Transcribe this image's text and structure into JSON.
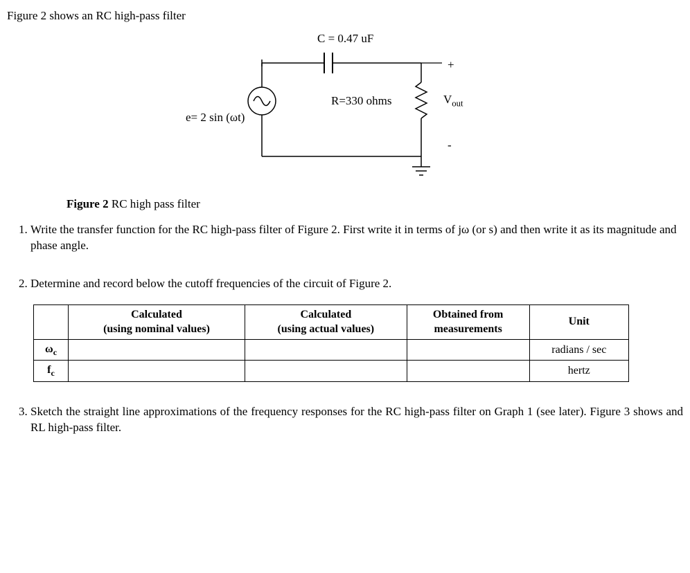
{
  "intro": "Figure 2 shows an RC high-pass filter",
  "circuit": {
    "c_label": "C = 0.47 uF",
    "r_label": "R=330 ohms",
    "source_label": "e= 2 sin (ωt)",
    "vout_label": "Vout",
    "plus": "+",
    "minus": "-"
  },
  "caption_bold": "Figure 2",
  "caption_rest": " RC high pass filter",
  "questions": {
    "q1": "Write the transfer function for the RC high-pass filter of Figure 2. First write it in terms of jω (or s) and then write it as its magnitude and phase angle.",
    "q2": "Determine and record below the cutoff frequencies of the circuit of Figure 2.",
    "q3": "Sketch the straight line approximations of the frequency responses for the RC high-pass filter on Graph 1 (see later). Figure 3 shows and RL high-pass filter."
  },
  "table": {
    "headers": {
      "blank": "",
      "calc_nom_1": "Calculated",
      "calc_nom_2": "(using nominal values)",
      "calc_act_1": "Calculated",
      "calc_act_2": "(using actual values)",
      "obt_1": "Obtained from",
      "obt_2": "measurements",
      "unit": "Unit"
    },
    "rows": [
      {
        "label_html": "ω<span class='sub'>c</span>",
        "calc_nom": "",
        "calc_act": "",
        "obt": "",
        "unit": "radians / sec"
      },
      {
        "label_html": "f<span class='sub'>c</span>",
        "calc_nom": "",
        "calc_act": "",
        "obt": "",
        "unit": "hertz"
      }
    ],
    "row1_label": "ωc",
    "row1_unit": "radians / sec",
    "row2_label": "fc",
    "row2_unit": "hertz"
  }
}
